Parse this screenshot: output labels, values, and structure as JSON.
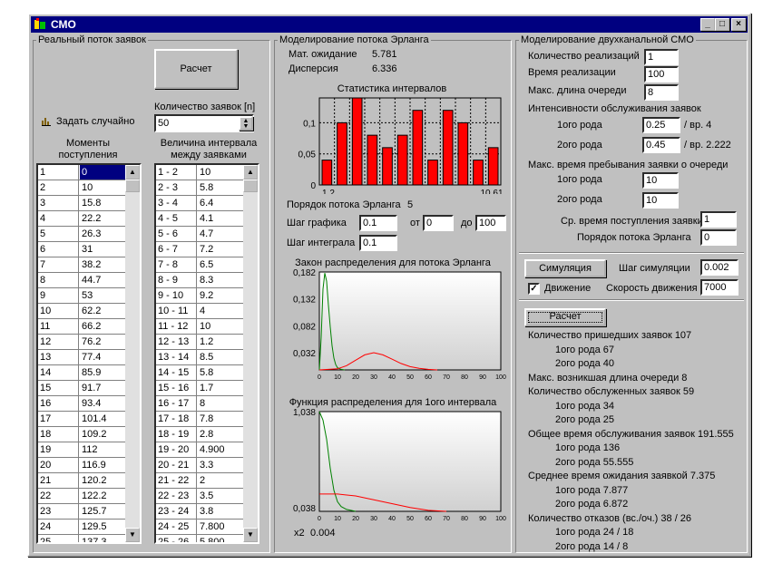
{
  "window": {
    "title": "СМО"
  },
  "left": {
    "group_title": "Реальный поток заявок",
    "calc_label": "Расчет",
    "count_label": "Количество заявок [n]",
    "count_value": "50",
    "random_label": "Задать случайно",
    "col1_title": "Моменты\nпоступления",
    "col2_title": "Величина интервала\nмежду заявками",
    "moments": [
      [
        "1",
        "0"
      ],
      [
        "2",
        "10"
      ],
      [
        "3",
        "15.8"
      ],
      [
        "4",
        "22.2"
      ],
      [
        "5",
        "26.3"
      ],
      [
        "6",
        "31"
      ],
      [
        "7",
        "38.2"
      ],
      [
        "8",
        "44.7"
      ],
      [
        "9",
        "53"
      ],
      [
        "10",
        "62.2"
      ],
      [
        "11",
        "66.2"
      ],
      [
        "12",
        "76.2"
      ],
      [
        "13",
        "77.4"
      ],
      [
        "14",
        "85.9"
      ],
      [
        "15",
        "91.7"
      ],
      [
        "16",
        "93.4"
      ],
      [
        "17",
        "101.4"
      ],
      [
        "18",
        "109.2"
      ],
      [
        "19",
        "112"
      ],
      [
        "20",
        "116.9"
      ],
      [
        "21",
        "120.2"
      ],
      [
        "22",
        "122.2"
      ],
      [
        "23",
        "125.7"
      ],
      [
        "24",
        "129.5"
      ],
      [
        "25",
        "137.3"
      ]
    ],
    "intervals": [
      [
        "1 - 2",
        "10"
      ],
      [
        "2 - 3",
        "5.8"
      ],
      [
        "3 - 4",
        "6.4"
      ],
      [
        "4 - 5",
        "4.1"
      ],
      [
        "5 - 6",
        "4.7"
      ],
      [
        "6 - 7",
        "7.2"
      ],
      [
        "7 - 8",
        "6.5"
      ],
      [
        "8 - 9",
        "8.3"
      ],
      [
        "9 - 10",
        "9.2"
      ],
      [
        "10 - 11",
        "4"
      ],
      [
        "11 - 12",
        "10"
      ],
      [
        "12 - 13",
        "1.2"
      ],
      [
        "13 - 14",
        "8.5"
      ],
      [
        "14 - 15",
        "5.8"
      ],
      [
        "15 - 16",
        "1.7"
      ],
      [
        "16 - 17",
        "8"
      ],
      [
        "17 - 18",
        "7.8"
      ],
      [
        "18 - 19",
        "2.8"
      ],
      [
        "19 - 20",
        "4.900"
      ],
      [
        "20 - 21",
        "3.3"
      ],
      [
        "21 - 22",
        "2"
      ],
      [
        "22 - 23",
        "3.5"
      ],
      [
        "23 - 24",
        "3.8"
      ],
      [
        "24 - 25",
        "7.800"
      ],
      [
        "25 - 26",
        "5.800"
      ]
    ]
  },
  "middle": {
    "group_title": "Моделирование потока Эрланга",
    "mean_label": "Мат. ожидание",
    "mean_value": "5.781",
    "disp_label": "Дисперсия",
    "disp_value": "6.336",
    "hist_title": "Статистика интервалов",
    "order_label": "Порядок потока Эрланга",
    "order_value": "5",
    "step_label": "Шаг графика",
    "step_value": "0.1",
    "from_label": "от",
    "from_value": "0",
    "to_label": "до",
    "to_value": "100",
    "int_step_label": "Шаг интеграла",
    "int_step_value": "0.1",
    "dist_title": "Закон распределения для потока Эрланга",
    "cdf_title": "Функция распределения для 1ого интервала",
    "x2_label": "x2",
    "x2_value": "0.004"
  },
  "chart_data": [
    {
      "type": "bar",
      "title": "Статистика интервалов",
      "values": [
        0.04,
        0.1,
        0.14,
        0.08,
        0.06,
        0.08,
        0.12,
        0.04,
        0.12,
        0.1,
        0.04,
        0.06
      ],
      "yticks": [
        "0",
        "0,05",
        "0,1"
      ],
      "ylim": [
        0,
        0.14
      ],
      "xstart_label": "1.2",
      "xend_label": "10.61",
      "color": "#ff0000"
    },
    {
      "type": "line",
      "title": "Закон распределения для потока Эрланга",
      "ylim": [
        0,
        0.182
      ],
      "yticks": [
        "0,182",
        "0,132",
        "0,082",
        "0,032"
      ],
      "xticks": [
        "0",
        "10",
        "20",
        "30",
        "40",
        "50",
        "60",
        "70",
        "80",
        "90",
        "100"
      ],
      "series": [
        {
          "color": "#008000",
          "x": [
            0,
            1,
            2,
            3,
            4,
            5,
            6,
            7,
            8,
            9,
            10,
            12,
            14
          ],
          "y": [
            0,
            0.06,
            0.15,
            0.18,
            0.165,
            0.12,
            0.08,
            0.045,
            0.022,
            0.01,
            0.004,
            0.001,
            0
          ]
        },
        {
          "color": "#ff0000",
          "x": [
            0,
            10,
            15,
            20,
            25,
            30,
            35,
            40,
            45,
            50,
            55,
            60,
            65
          ],
          "y": [
            0,
            0.002,
            0.008,
            0.018,
            0.028,
            0.032,
            0.028,
            0.02,
            0.012,
            0.006,
            0.003,
            0.001,
            0
          ]
        }
      ]
    },
    {
      "type": "line",
      "title": "Функция распределения для 1ого интервала",
      "ylim": [
        0,
        1.038
      ],
      "yticks": [
        "1,038",
        "0,038"
      ],
      "xticks": [
        "0",
        "10",
        "20",
        "30",
        "40",
        "50",
        "60",
        "70",
        "80",
        "90",
        "100"
      ],
      "series": [
        {
          "color": "#008000",
          "x": [
            0,
            2,
            4,
            6,
            8,
            10,
            12,
            15,
            20
          ],
          "y": [
            1.038,
            0.95,
            0.75,
            0.45,
            0.22,
            0.1,
            0.05,
            0.02,
            0
          ]
        },
        {
          "color": "#ff0000",
          "x": [
            0,
            10,
            20,
            30,
            40,
            50,
            60,
            70
          ],
          "y": [
            0.18,
            0.18,
            0.16,
            0.12,
            0.08,
            0.04,
            0.01,
            0
          ]
        }
      ]
    }
  ],
  "right": {
    "group_title": "Моделирование двухканальной СМО",
    "impl_count_label": "Количество реализаций",
    "impl_count_value": "1",
    "impl_time_label": "Время реализации",
    "impl_time_value": "100",
    "max_queue_label": "Макс. длина очереди",
    "max_queue_value": "8",
    "intensity_label": "Интенсивности обслуживания заявок",
    "type1_label": "1ого рода",
    "type1_value": "0.25",
    "type1_note": "/ вр. 4",
    "type2_label": "2ого рода",
    "type2_value": "0.45",
    "type2_note": "/ вр. 2.222",
    "max_stay_label": "Макс. время пребывания заявки о очереди",
    "stay1_label": "1ого рода",
    "stay1_value": "10",
    "stay2_label": "2ого рода",
    "stay2_value": "10",
    "avg_arrival_label": "Ср. время поступления заявки",
    "avg_arrival_value": "1",
    "erlang_order_label": "Порядок потока Эрланга",
    "erlang_order_value": "0",
    "simulate_label": "Симуляция",
    "sim_step_label": "Шаг симуляции",
    "sim_step_value": "0.002",
    "motion_label": "Движение",
    "motion_checked": "✓",
    "speed_label": "Скорость движения",
    "speed_value": "7000",
    "calc_label": "Расчет",
    "results": [
      {
        "text": "Количество пришедших заявок  107",
        "indent": false
      },
      {
        "text": "1ого рода  67",
        "indent": true
      },
      {
        "text": "2ого рода  40",
        "indent": true
      },
      {
        "text": "Макс. возникшая длина очереди 8",
        "indent": false
      },
      {
        "text": "Количество обслуженных заявок  59",
        "indent": false
      },
      {
        "text": "1ого рода  34",
        "indent": true
      },
      {
        "text": "2ого рода  25",
        "indent": true
      },
      {
        "text": "Общее время обслуживания заявок  191.555",
        "indent": false
      },
      {
        "text": "1ого рода  136",
        "indent": true
      },
      {
        "text": "2ого рода  55.555",
        "indent": true
      },
      {
        "text": "Среднее время ожидания заявкой  7.375",
        "indent": false
      },
      {
        "text": "1ого рода  7.877",
        "indent": true
      },
      {
        "text": "2ого рода  6.872",
        "indent": true
      },
      {
        "text": "Количество отказов (вс./оч.)  38  / 26",
        "indent": false
      },
      {
        "text": "1ого рода  24  / 18",
        "indent": true
      },
      {
        "text": "2ого рода  14  / 8",
        "indent": true
      }
    ]
  }
}
